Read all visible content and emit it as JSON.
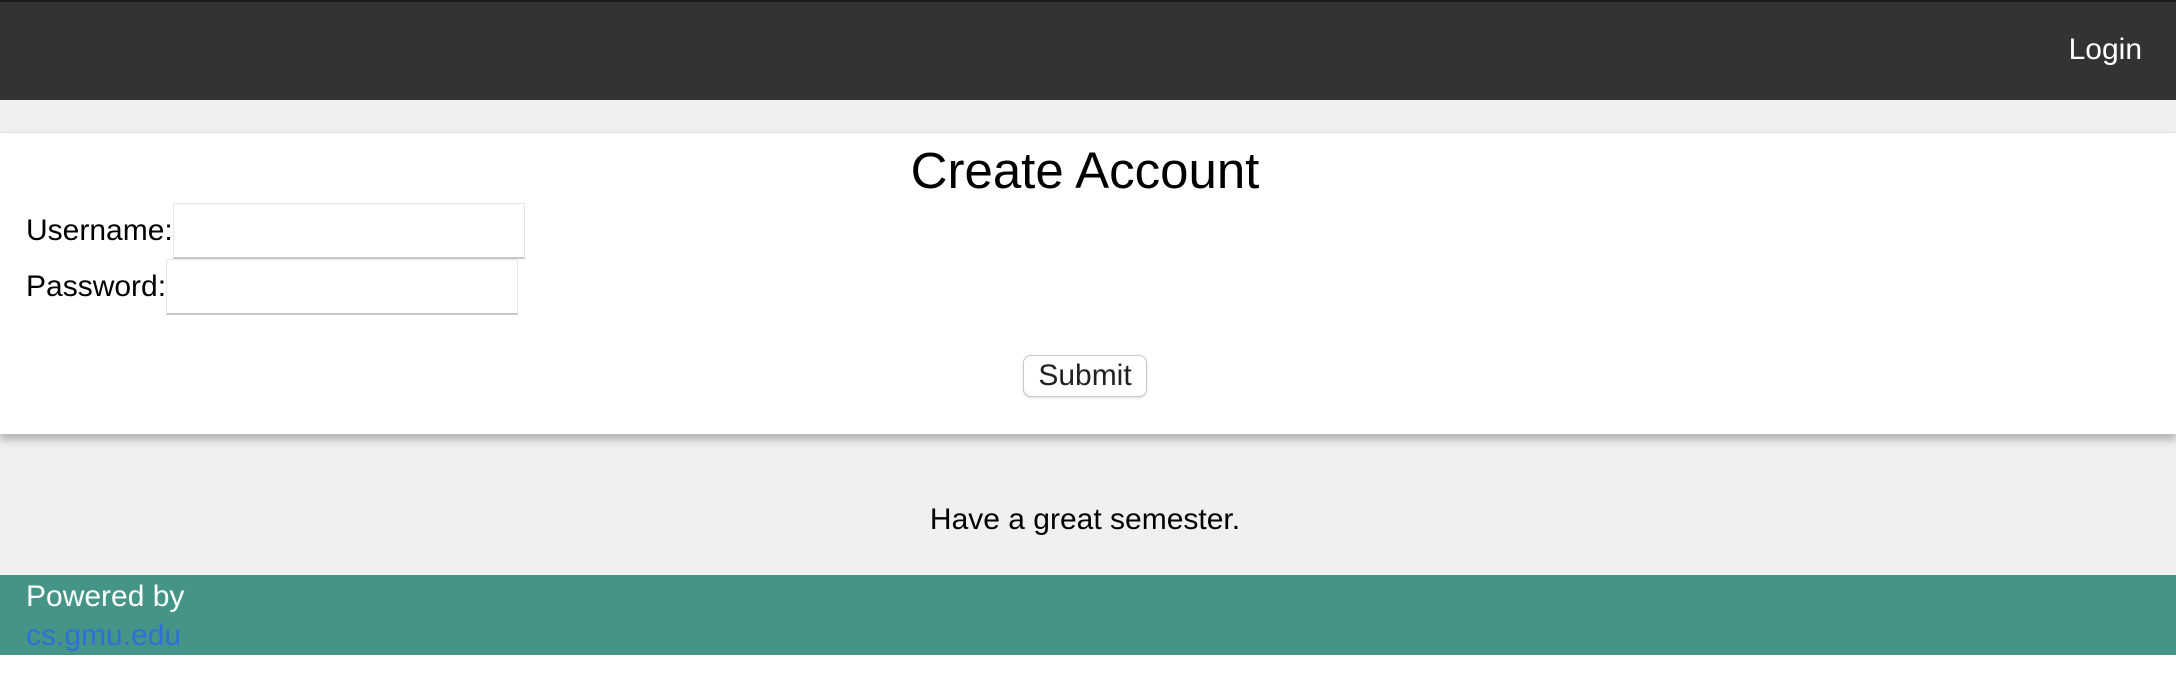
{
  "nav": {
    "login_label": "Login"
  },
  "form": {
    "title": "Create Account",
    "username_label": "Username:",
    "username_value": "",
    "password_label": "Password:",
    "password_value": "",
    "submit_label": "Submit"
  },
  "message": "Have a great semester.",
  "footer": {
    "powered_by": "Powered by",
    "link_text": "cs.gmu.edu"
  },
  "colors": {
    "topbar": "#333333",
    "footer": "#449588",
    "link": "#2f6fd8",
    "band": "#f0f0f0"
  }
}
